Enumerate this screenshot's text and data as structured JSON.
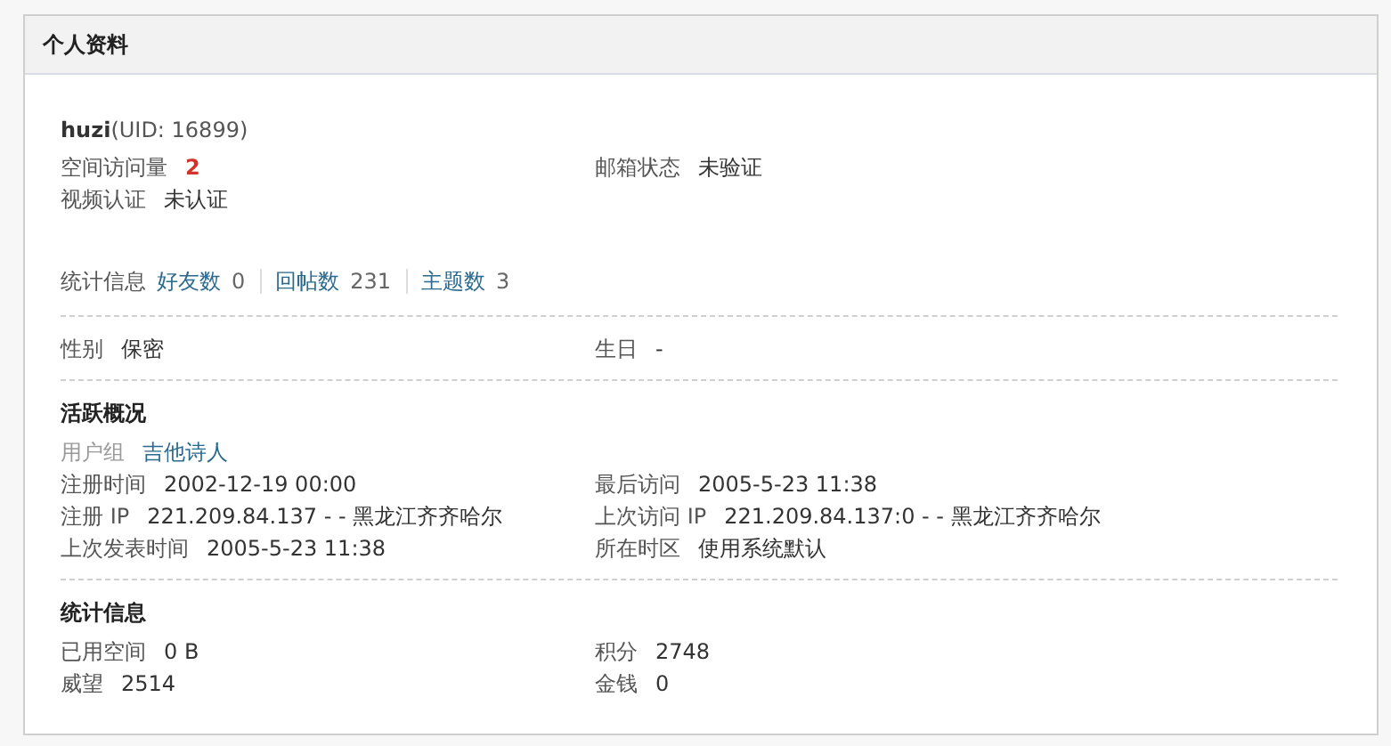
{
  "panel": {
    "title": "个人资料"
  },
  "profile": {
    "name": "huzi",
    "uid": "(UID: 16899)"
  },
  "sections": [
    {
      "kind": "fields",
      "divided": false,
      "items": [
        {
          "label": "空间访问量",
          "value": "2",
          "kind": "highlight"
        },
        {
          "label": "邮箱状态",
          "value": "未验证",
          "kind": "plain"
        },
        {
          "label": "视频认证",
          "value": "未认证",
          "kind": "plain"
        }
      ]
    },
    {
      "kind": "stats",
      "divided": false,
      "label": "统计信息",
      "links": [
        {
          "label": "好友数",
          "value": "0"
        },
        {
          "label": "回帖数",
          "value": "231"
        },
        {
          "label": "主题数",
          "value": "3"
        }
      ]
    },
    {
      "kind": "fields",
      "divided": true,
      "items": [
        {
          "label": "性别",
          "value": "保密",
          "kind": "plain"
        },
        {
          "label": "生日",
          "value": "-",
          "kind": "plain"
        }
      ]
    },
    {
      "kind": "fields",
      "divided": true,
      "title": "活跃概况",
      "items": [
        {
          "label": "用户组",
          "value": "吉他诗人",
          "kind": "link"
        },
        {
          "label": "注册时间",
          "value": "2002-12-19 00:00",
          "kind": "plain"
        },
        {
          "label": "最后访问",
          "value": "2005-5-23 11:38",
          "kind": "plain"
        },
        {
          "label": "注册 IP",
          "value": "221.209.84.137 - - 黑龙江齐齐哈尔",
          "kind": "plain"
        },
        {
          "label": "上次访问 IP",
          "value": "221.209.84.137:0 - - 黑龙江齐齐哈尔",
          "kind": "plain"
        },
        {
          "label": "上次发表时间",
          "value": "2005-5-23 11:38",
          "kind": "plain"
        },
        {
          "label": "所在时区",
          "value": "使用系统默认",
          "kind": "plain"
        }
      ]
    },
    {
      "kind": "fields",
      "divided": true,
      "title": "统计信息",
      "items": [
        {
          "label": "已用空间",
          "value": "0 B",
          "kind": "plain"
        },
        {
          "label": "积分",
          "value": "2748",
          "kind": "plain"
        },
        {
          "label": "威望",
          "value": "2514",
          "kind": "plain"
        },
        {
          "label": "金钱",
          "value": "0",
          "kind": "plain"
        }
      ]
    }
  ]
}
